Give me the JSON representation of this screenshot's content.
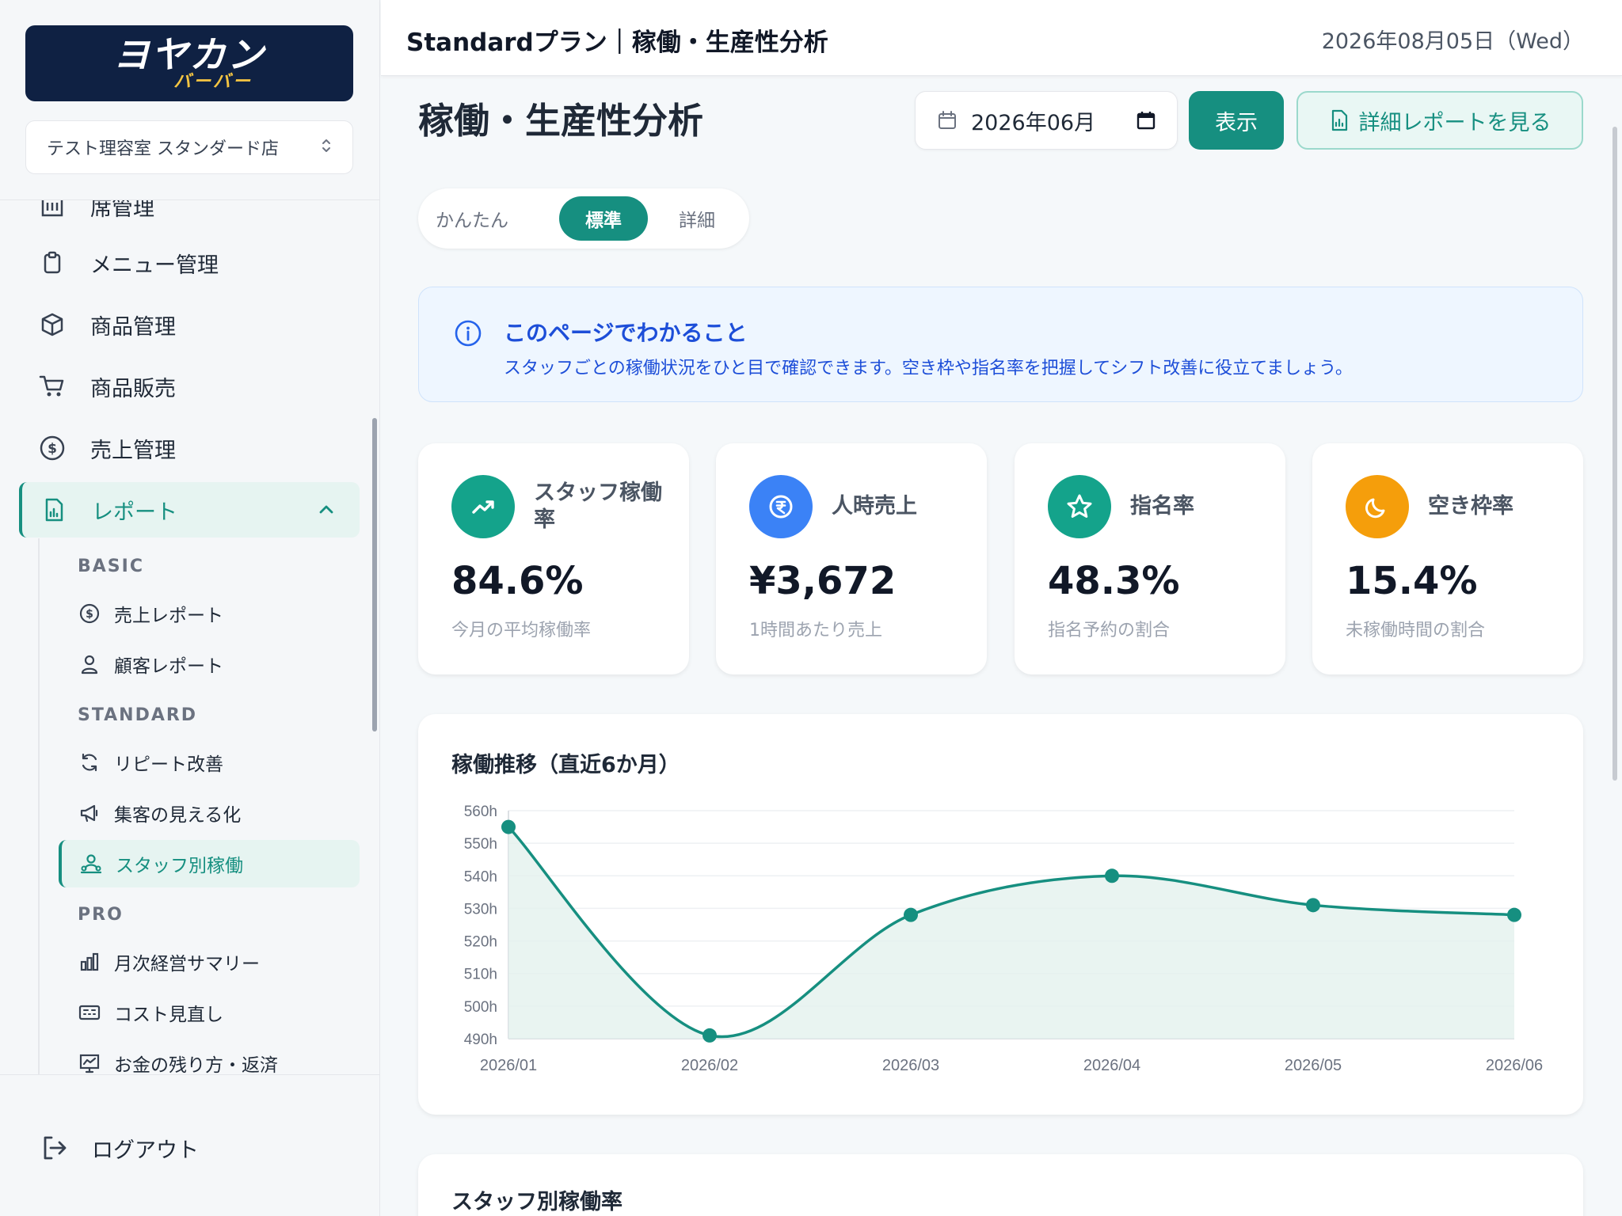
{
  "sidebar": {
    "logo_main": "ヨヤカン",
    "logo_sub": "バーバー",
    "store_name": "テスト理容室 スタンダード店",
    "partial_item": "席管理",
    "items": [
      {
        "label": "メニュー管理",
        "icon": "clipboard-icon"
      },
      {
        "label": "商品管理",
        "icon": "box-icon"
      },
      {
        "label": "商品販売",
        "icon": "cart-icon"
      },
      {
        "label": "売上管理",
        "icon": "dollar-circle-icon"
      },
      {
        "label": "レポート",
        "icon": "report-icon"
      }
    ],
    "sections": {
      "basic": "BASIC",
      "standard": "STANDARD",
      "pro": "PRO"
    },
    "sub_items": [
      {
        "label": "売上レポート",
        "icon": "dollar-circle-icon"
      },
      {
        "label": "顧客レポート",
        "icon": "user-icon"
      },
      {
        "label": "リピート改善",
        "icon": "refresh-icon"
      },
      {
        "label": "集客の見える化",
        "icon": "megaphone-icon"
      },
      {
        "label": "スタッフ別稼働",
        "icon": "staff-icon"
      },
      {
        "label": "月次経営サマリー",
        "icon": "bar-chart-icon"
      },
      {
        "label": "コスト見直し",
        "icon": "calculator-icon"
      },
      {
        "label": "お金の残り方・返済",
        "icon": "trend-board-icon"
      }
    ],
    "logout": "ログアウト"
  },
  "header": {
    "title": "Standardプラン｜稼働・生産性分析",
    "date": "2026年08月05日（Wed）"
  },
  "page": {
    "title": "稼働・生産性分析",
    "month_value": "2026年06月",
    "show_button": "表示",
    "detail_button": "詳細レポートを見る",
    "segments": [
      "かんたん",
      "標準",
      "詳細"
    ],
    "active_segment": "標準"
  },
  "info": {
    "title": "このページでわかること",
    "text": "スタッフごとの稼働状況をひと目で確認できます。空き枠や指名率を把握してシフト改善に役立てましょう。"
  },
  "kpis": [
    {
      "title": "スタッフ稼働率",
      "value": "84.6%",
      "sub": "今月の平均稼働率",
      "color": "#14a38b",
      "icon": "trend-up-icon"
    },
    {
      "title": "人時売上",
      "value": "¥3,672",
      "sub": "1時間あたり売上",
      "color": "#3b82f6",
      "icon": "currency-icon"
    },
    {
      "title": "指名率",
      "value": "48.3%",
      "sub": "指名予約の割合",
      "color": "#14a38b",
      "icon": "star-icon"
    },
    {
      "title": "空き枠率",
      "value": "15.4%",
      "sub": "未稼働時間の割合",
      "color": "#f59e0b",
      "icon": "moon-icon"
    }
  ],
  "chart_data": {
    "type": "line",
    "title": "稼働推移（直近6か月）",
    "categories": [
      "2026/01",
      "2026/02",
      "2026/03",
      "2026/04",
      "2026/05",
      "2026/06"
    ],
    "values": [
      555,
      491,
      528,
      540,
      531,
      528
    ],
    "y_ticks": [
      "490h",
      "500h",
      "510h",
      "520h",
      "530h",
      "540h",
      "550h",
      "560h"
    ],
    "ylim": [
      490,
      560
    ],
    "grid": true,
    "color": "#168f80",
    "fill": "#e3f1ee"
  },
  "staff_section": {
    "title": "スタッフ別稼働率"
  }
}
